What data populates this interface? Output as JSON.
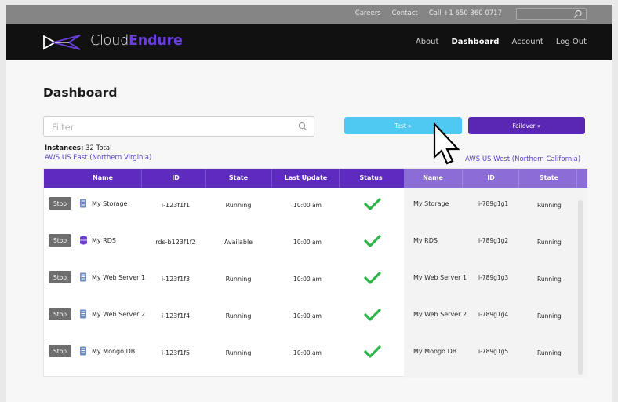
{
  "topbar": {
    "links": [
      "Careers",
      "Contact",
      "Call +1 650 360 0717"
    ],
    "search_placeholder": ""
  },
  "header": {
    "logo_light": "Cloud",
    "logo_bold": "Endure",
    "nav": [
      "About",
      "Dashboard",
      "Account",
      "Log Out"
    ],
    "active_nav": "Dashboard"
  },
  "page_title": "Dashboard",
  "filter_placeholder": "Filter",
  "buttons": {
    "test": "Test »",
    "failover": "Failover »"
  },
  "instances": {
    "label": "Instances:",
    "value": "32 Total"
  },
  "regions": {
    "source": "AWS US East (Northern Virginia)",
    "target": "AWS US West (Northern California)"
  },
  "columns_left": [
    "Name",
    "ID",
    "State",
    "Last Update",
    "Status"
  ],
  "columns_right": [
    "Name",
    "ID",
    "State"
  ],
  "stop_label": "Stop",
  "rows": [
    {
      "name": "My Storage",
      "id": "i-123f1f1",
      "state": "Running",
      "updated": "10:00 am",
      "icon": "document-icon",
      "r_name": "My Storage",
      "r_id": "i-789g1g1",
      "r_state": "Running"
    },
    {
      "name": "My RDS",
      "id": "rds-b123f1f2",
      "state": "Available",
      "updated": "10:00 am",
      "icon": "database-icon",
      "r_name": "My RDS",
      "r_id": "i-789g1g2",
      "r_state": "Running"
    },
    {
      "name": "My Web Server 1",
      "id": "i-123f1f3",
      "state": "Running",
      "updated": "10:00 am",
      "icon": "document-icon",
      "r_name": "My Web Server 1",
      "r_id": "i-789g1g3",
      "r_state": "Running"
    },
    {
      "name": "My Web Server 2",
      "id": "i-123f1f4",
      "state": "Running",
      "updated": "10:00 am",
      "icon": "document-icon",
      "r_name": "My Web Server 2",
      "r_id": "i-789g1g4",
      "r_state": "Running"
    },
    {
      "name": "My Mongo DB",
      "id": "i-123f1f5",
      "state": "Running",
      "updated": "10:00 am",
      "icon": "document-icon",
      "r_name": "My Mongo DB",
      "r_id": "i-789g1g5",
      "r_state": "Running"
    }
  ],
  "colors": {
    "accent_purple": "#5e2bc0",
    "accent_light_purple": "#8c6cd6",
    "test_blue": "#4fc8f2",
    "check_green": "#2fb44a"
  }
}
